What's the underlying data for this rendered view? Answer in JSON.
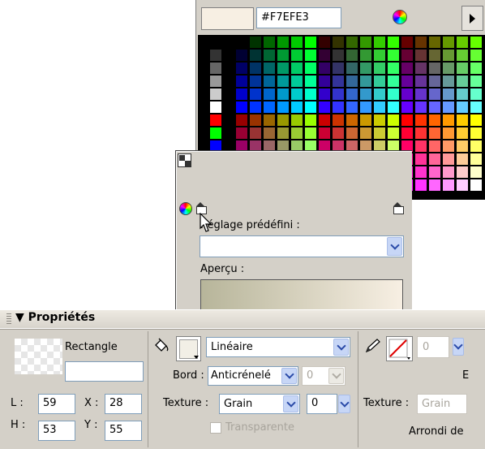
{
  "swatches": {
    "hex_value": "#F7EFE3",
    "preview_color": "#F7EFE3",
    "menu_label": "swatch options"
  },
  "gradient_editor": {
    "preset_label": "Réglage prédéfini :",
    "preset_value": "",
    "preview_label": "Aperçu :",
    "start_color": "#B7B59A",
    "end_color": "#F7EFE3"
  },
  "properties": {
    "title": "Propriétés",
    "shape_name": "Rectangle",
    "instance_name": "",
    "L_label": "L :",
    "L_value": "59",
    "X_label": "X :",
    "X_value": "28",
    "H_label": "H :",
    "H_value": "53",
    "Y_label": "Y :",
    "Y_value": "55",
    "fill_type": "Linéaire",
    "edge_label": "Bord :",
    "edge_value": "Anticrénelé",
    "edge_amount": "0",
    "texture_label": "Texture :",
    "texture_value": "Grain",
    "texture_amount": "0",
    "transparent_label": "Transparente",
    "stroke_width": "0",
    "stroke_texture_label": "Texture :",
    "stroke_texture_value": "Grain",
    "stroke_edge_letter": "E",
    "roundness_label": "Arrondi de"
  },
  "colors": {
    "panel": "#D4D0C8",
    "combo_border": "#7F9DB9",
    "combo_button": "#C7D6F6"
  }
}
